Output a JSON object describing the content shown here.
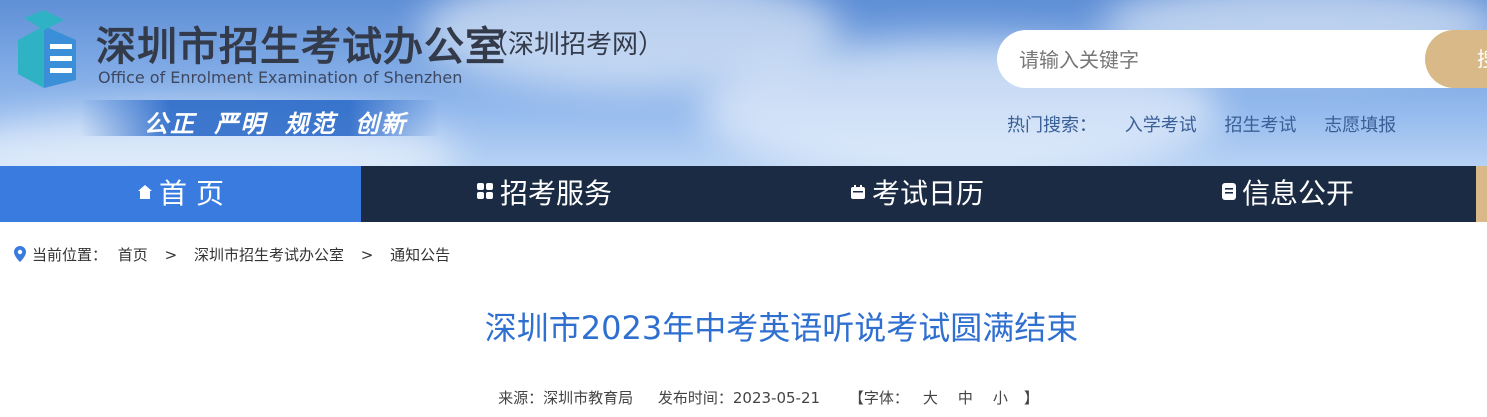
{
  "header": {
    "site_title": "深圳市招生考试办公室",
    "site_subtitle": "（深圳招考网）",
    "site_title_en": "Office of Enrolment Examination of Shenzhen",
    "slogan": "公正 严明 规范 创新"
  },
  "search": {
    "placeholder": "请输入关键字",
    "button_label": "搜索",
    "hot_label": "热门搜索：",
    "hot_links": [
      "入学考试",
      "招生考试",
      "志愿填报"
    ]
  },
  "nav": {
    "items": [
      {
        "label": "首 页",
        "icon": "home-icon"
      },
      {
        "label": "招考服务",
        "icon": "grid-icon"
      },
      {
        "label": "考试日历",
        "icon": "calendar-icon"
      },
      {
        "label": "信息公开",
        "icon": "document-icon"
      }
    ]
  },
  "breadcrumb": {
    "prefix": "当前位置：",
    "items": [
      "首页",
      "深圳市招生考试办公室",
      "通知公告"
    ],
    "separator": ">"
  },
  "article": {
    "title": "深圳市2023年中考英语听说考试圆满结束",
    "source": "来源：深圳市教育局",
    "published": "发布时间：2023-05-21",
    "font_label_open": "【字体：",
    "font_sizes": [
      "大",
      "中",
      "小"
    ],
    "font_label_close": "】"
  },
  "colors": {
    "nav_bg": "#1b2b44",
    "nav_active": "#3a7be0",
    "accent_gold": "#d8b987",
    "title_blue": "#2f6fd0"
  }
}
